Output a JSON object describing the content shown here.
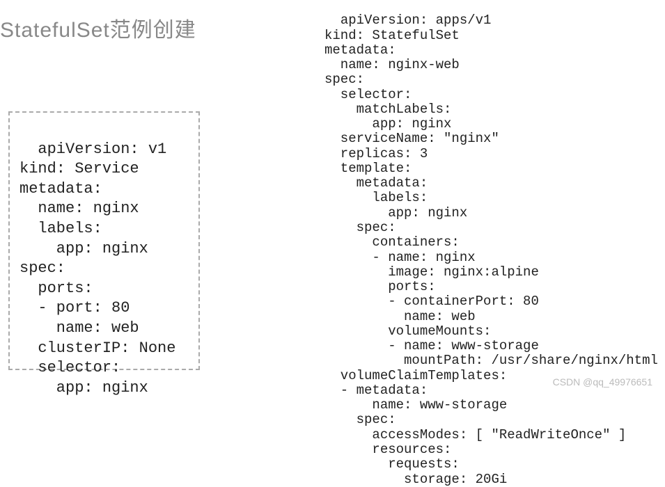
{
  "heading": "StatefulSet范例创建",
  "left_code": "apiVersion: v1\nkind: Service\nmetadata:\n  name: nginx\n  labels:\n    app: nginx\nspec:\n  ports:\n  - port: 80\n    name: web\n  clusterIP: None\n  selector:\n    app: nginx",
  "right_code": "apiVersion: apps/v1\nkind: StatefulSet\nmetadata:\n  name: nginx-web\nspec:\n  selector:\n    matchLabels:\n      app: nginx\n  serviceName: \"nginx\"\n  replicas: 3\n  template:\n    metadata:\n      labels:\n        app: nginx\n    spec:\n      containers:\n      - name: nginx\n        image: nginx:alpine\n        ports:\n        - containerPort: 80\n          name: web\n        volumeMounts:\n        - name: www-storage\n          mountPath: /usr/share/nginx/html\n  volumeClaimTemplates:\n  - metadata:\n      name: www-storage\n    spec:\n      accessModes: [ \"ReadWriteOnce\" ]\n      resources:\n        requests:\n          storage: 20Gi",
  "watermark": "CSDN @qq_49976651"
}
